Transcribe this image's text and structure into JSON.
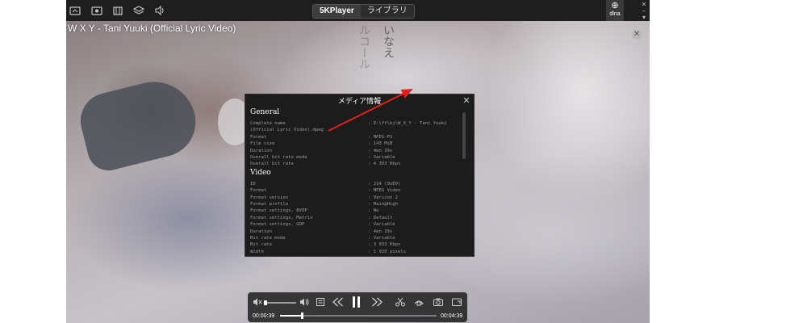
{
  "toolbar": {
    "icons": [
      "screenshot-icon",
      "record-icon",
      "video-icon",
      "layers-icon",
      "volume-icon"
    ],
    "tabs": [
      {
        "label": "5KPlayer",
        "active": true
      },
      {
        "label": "ライブラリ",
        "active": false
      }
    ],
    "dlna_label": "dlna"
  },
  "video": {
    "title": "W X Y - Tani Yuuki (Official Lyric Video)",
    "lyrics_text_1": "いなえ",
    "lyrics_text_2": "ルコール"
  },
  "media_info": {
    "title": "メディア情報",
    "sections": [
      {
        "name": "General",
        "rows": [
          {
            "key": "Complete name",
            "value": ": D:\\ff\\kj\\W_X_Y - Tani Yuuki"
          },
          {
            "key": "(Official Lyric Video).mpeg",
            "value": ""
          },
          {
            "key": "Format",
            "value": ": MPEG-PS"
          },
          {
            "key": "File size",
            "value": ": 143 MiB"
          },
          {
            "key": "Duration",
            "value": ": 4mn 39s"
          },
          {
            "key": "Overall bit rate mode",
            "value": ": Variable"
          },
          {
            "key": "Overall bit rate",
            "value": ": 4 303 Kbps"
          }
        ]
      },
      {
        "name": "Video",
        "rows": [
          {
            "key": "ID",
            "value": ": 224 (0xE0)"
          },
          {
            "key": "Format",
            "value": ": MPEG Video"
          },
          {
            "key": "Format version",
            "value": ": Version 2"
          },
          {
            "key": "Format profile",
            "value": ": Main@High"
          },
          {
            "key": "Format settings, BVOP",
            "value": ": No"
          },
          {
            "key": "Format settings, Matrix",
            "value": ": Default"
          },
          {
            "key": "Format settings, GOP",
            "value": ": Variable"
          },
          {
            "key": "Duration",
            "value": ": 4mn 39s"
          },
          {
            "key": "Bit rate mode",
            "value": ": Variable"
          },
          {
            "key": "Bit rate",
            "value": ": 3 833 Kbps"
          },
          {
            "key": "Width",
            "value": ": 1 920 pixels"
          }
        ]
      }
    ]
  },
  "player": {
    "current_time": "00:00:39",
    "total_time": "00:04:39",
    "volume_fraction": 0.05,
    "progress_fraction": 0.14,
    "accent": "#ffffff",
    "arrow_color": "#e0201c"
  }
}
